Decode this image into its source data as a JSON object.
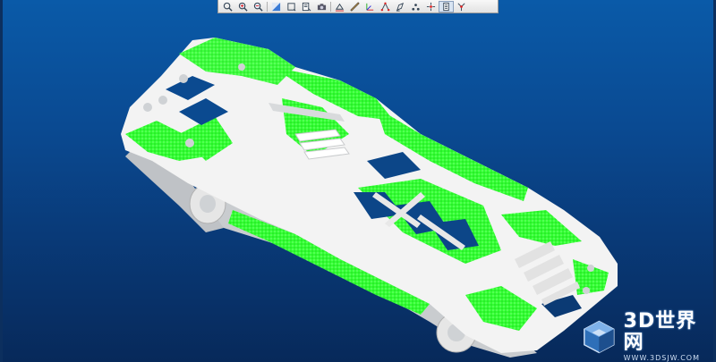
{
  "app": {
    "view": "3D model viewer",
    "model_colors": {
      "part": "#f2f2f2",
      "shade": "#b9bcc0",
      "highlight": "#33ff33",
      "background_top": "#0a5aa8",
      "background_bottom": "#07295a"
    }
  },
  "toolbar": {
    "buttons": [
      {
        "icon": "zoom-fit-icon",
        "active": false
      },
      {
        "icon": "zoom-in-icon",
        "active": false
      },
      {
        "icon": "zoom-out-icon",
        "active": false
      },
      {
        "icon": "shaded-view-icon",
        "active": false
      },
      {
        "icon": "wireframe-box-icon",
        "active": false
      },
      {
        "icon": "view-orient-icon",
        "active": false
      },
      {
        "icon": "camera-icon",
        "active": false
      },
      {
        "icon": "section-view-icon",
        "active": false
      },
      {
        "icon": "measure-icon",
        "active": false
      },
      {
        "icon": "axis-icon",
        "active": false
      },
      {
        "icon": "transform-icon",
        "active": false
      },
      {
        "icon": "sketch-icon",
        "active": false
      },
      {
        "icon": "point-icon",
        "active": false
      },
      {
        "icon": "explode-icon",
        "active": false
      },
      {
        "icon": "properties-icon",
        "active": true
      },
      {
        "icon": "network-icon",
        "active": false
      }
    ]
  },
  "watermark": {
    "title": "3D世界网",
    "url": "WWW.3DSJW.COM"
  }
}
